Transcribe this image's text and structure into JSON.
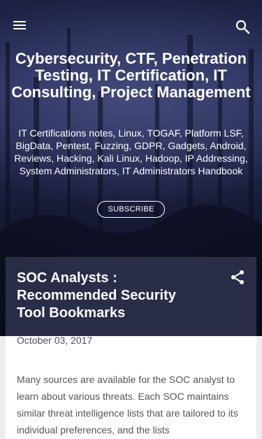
{
  "header": {
    "menu_icon": "hamburger-menu-icon",
    "search_icon": "search-icon",
    "blog_title": "Cybersecurity, CTF, Penetration Testing, IT Certification, IT Consulting, Project Management",
    "blog_description": "IT Certifications notes, Linux, TOGAF, Platform LSF, BigData, Pentest, Fuzzing, GDPR, Gadgets, Android, Reviews, Hacking, Kali Linux, Hadoop, IP Addressing, System Administrators, IT Administrators Handbook",
    "subscribe_label": "SUBSCRIBE"
  },
  "post": {
    "title": "SOC Analysts : Recommended Security Tool Bookmarks",
    "share_icon": "share-icon",
    "date": "October 03, 2017",
    "body": "Many sources are available for the SOC analyst to learn about various threats. Each SOC maintains similar threat intelligence lists that are tailored to its individual preferences, and the lists"
  },
  "colors": {
    "hero_bg": "#1c2040",
    "card_header_bg": "#2a2d48",
    "page_bg": "#eeeeee",
    "text_light": "#ffffff",
    "text_muted": "#555555"
  }
}
